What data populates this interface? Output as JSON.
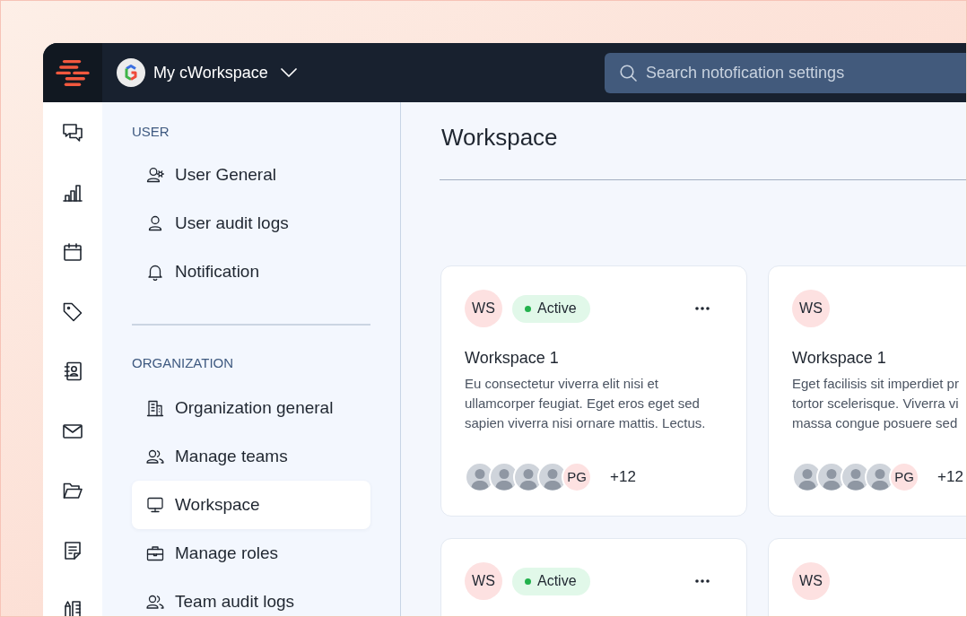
{
  "topbar": {
    "workspace_name": "My cWorkspace"
  },
  "search": {
    "placeholder": "Search notofication settings"
  },
  "sidebar": {
    "sections": [
      {
        "heading": "USER",
        "items": [
          {
            "label": "User General",
            "selected": false
          },
          {
            "label": "User audit logs",
            "selected": false
          },
          {
            "label": "Notification",
            "selected": false
          }
        ]
      },
      {
        "heading": "ORGANIZATION",
        "items": [
          {
            "label": "Organization general",
            "selected": false
          },
          {
            "label": "Manage teams",
            "selected": false
          },
          {
            "label": "Workspace",
            "selected": true
          },
          {
            "label": "Manage roles",
            "selected": false
          },
          {
            "label": "Team audit logs",
            "selected": false
          }
        ]
      }
    ]
  },
  "main": {
    "title": "Workspace",
    "cards": [
      {
        "initials": "WS",
        "status": "Active",
        "menu": true,
        "title": "Workspace 1",
        "description": "Eu consectetur viverra elit nisi et\nullamcorper feugiat. Eget eros eget sed\nsapien viverra nisi ornare mattis. Lectus.",
        "members": [
          {
            "kind": "photo"
          },
          {
            "kind": "photo"
          },
          {
            "kind": "photo"
          },
          {
            "kind": "photo"
          },
          {
            "kind": "initials",
            "initials": "PG"
          }
        ],
        "extra_members": "+12"
      },
      {
        "initials": "WS",
        "menu": false,
        "title": "Workspace 1",
        "description": "Eget facilisis sit imperdiet pr\ntortor scelerisque. Viverra vi\nmassa congue posuere sed",
        "members": [
          {
            "kind": "photo"
          },
          {
            "kind": "photo"
          },
          {
            "kind": "photo"
          },
          {
            "kind": "photo"
          },
          {
            "kind": "initials",
            "initials": "PG"
          }
        ],
        "extra_members": "+12"
      },
      {
        "initials": "WS",
        "status": "Active",
        "menu": true
      },
      {
        "initials": "WS",
        "menu": false
      }
    ]
  }
}
